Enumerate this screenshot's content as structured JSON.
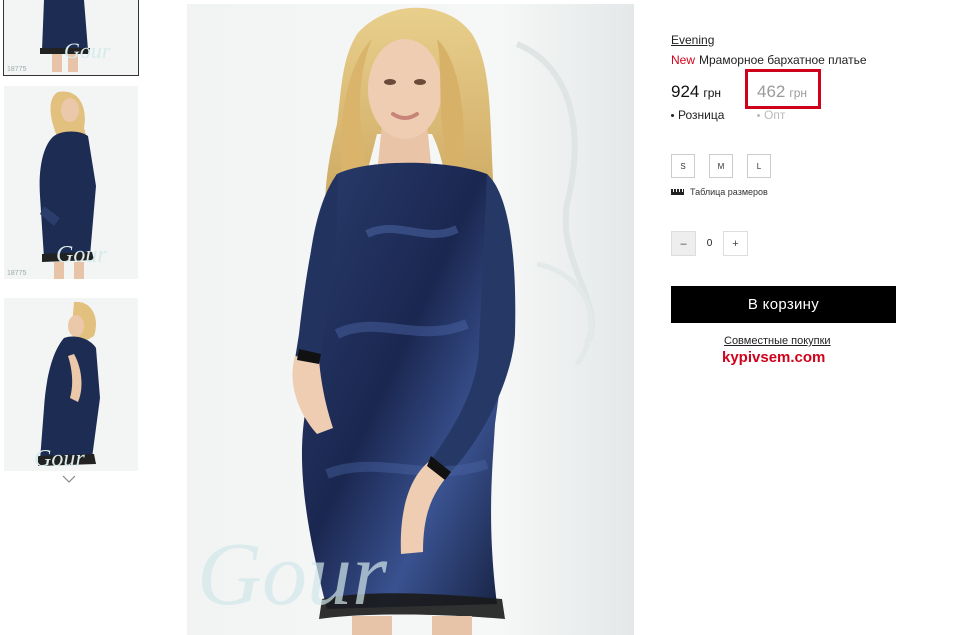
{
  "thumbnails": [
    {
      "code": "18775",
      "active": true
    },
    {
      "code": "18775",
      "active": false
    },
    {
      "code": "",
      "active": false
    }
  ],
  "product": {
    "brand": "Evening",
    "badge": "New",
    "title": "Мраморное бархатное платье"
  },
  "prices": {
    "retail_value": "924",
    "opt_value": "462",
    "currency": "грн",
    "retail_label": "Розница",
    "opt_label": "Опт",
    "highlight_color": "#d0021b"
  },
  "sizes": [
    "S",
    "M",
    "L"
  ],
  "size_table_label": "Таблица размеров",
  "quantity": {
    "minus": "–",
    "value": "0",
    "plus": "+"
  },
  "cart_button": "В корзину",
  "joint_purchases_link": "Совместные покупки",
  "site_watermark": "kypivsem.com",
  "colors": {
    "accent_red": "#d0021b",
    "cart_bg": "#000000",
    "dress": "#1d2c52"
  }
}
